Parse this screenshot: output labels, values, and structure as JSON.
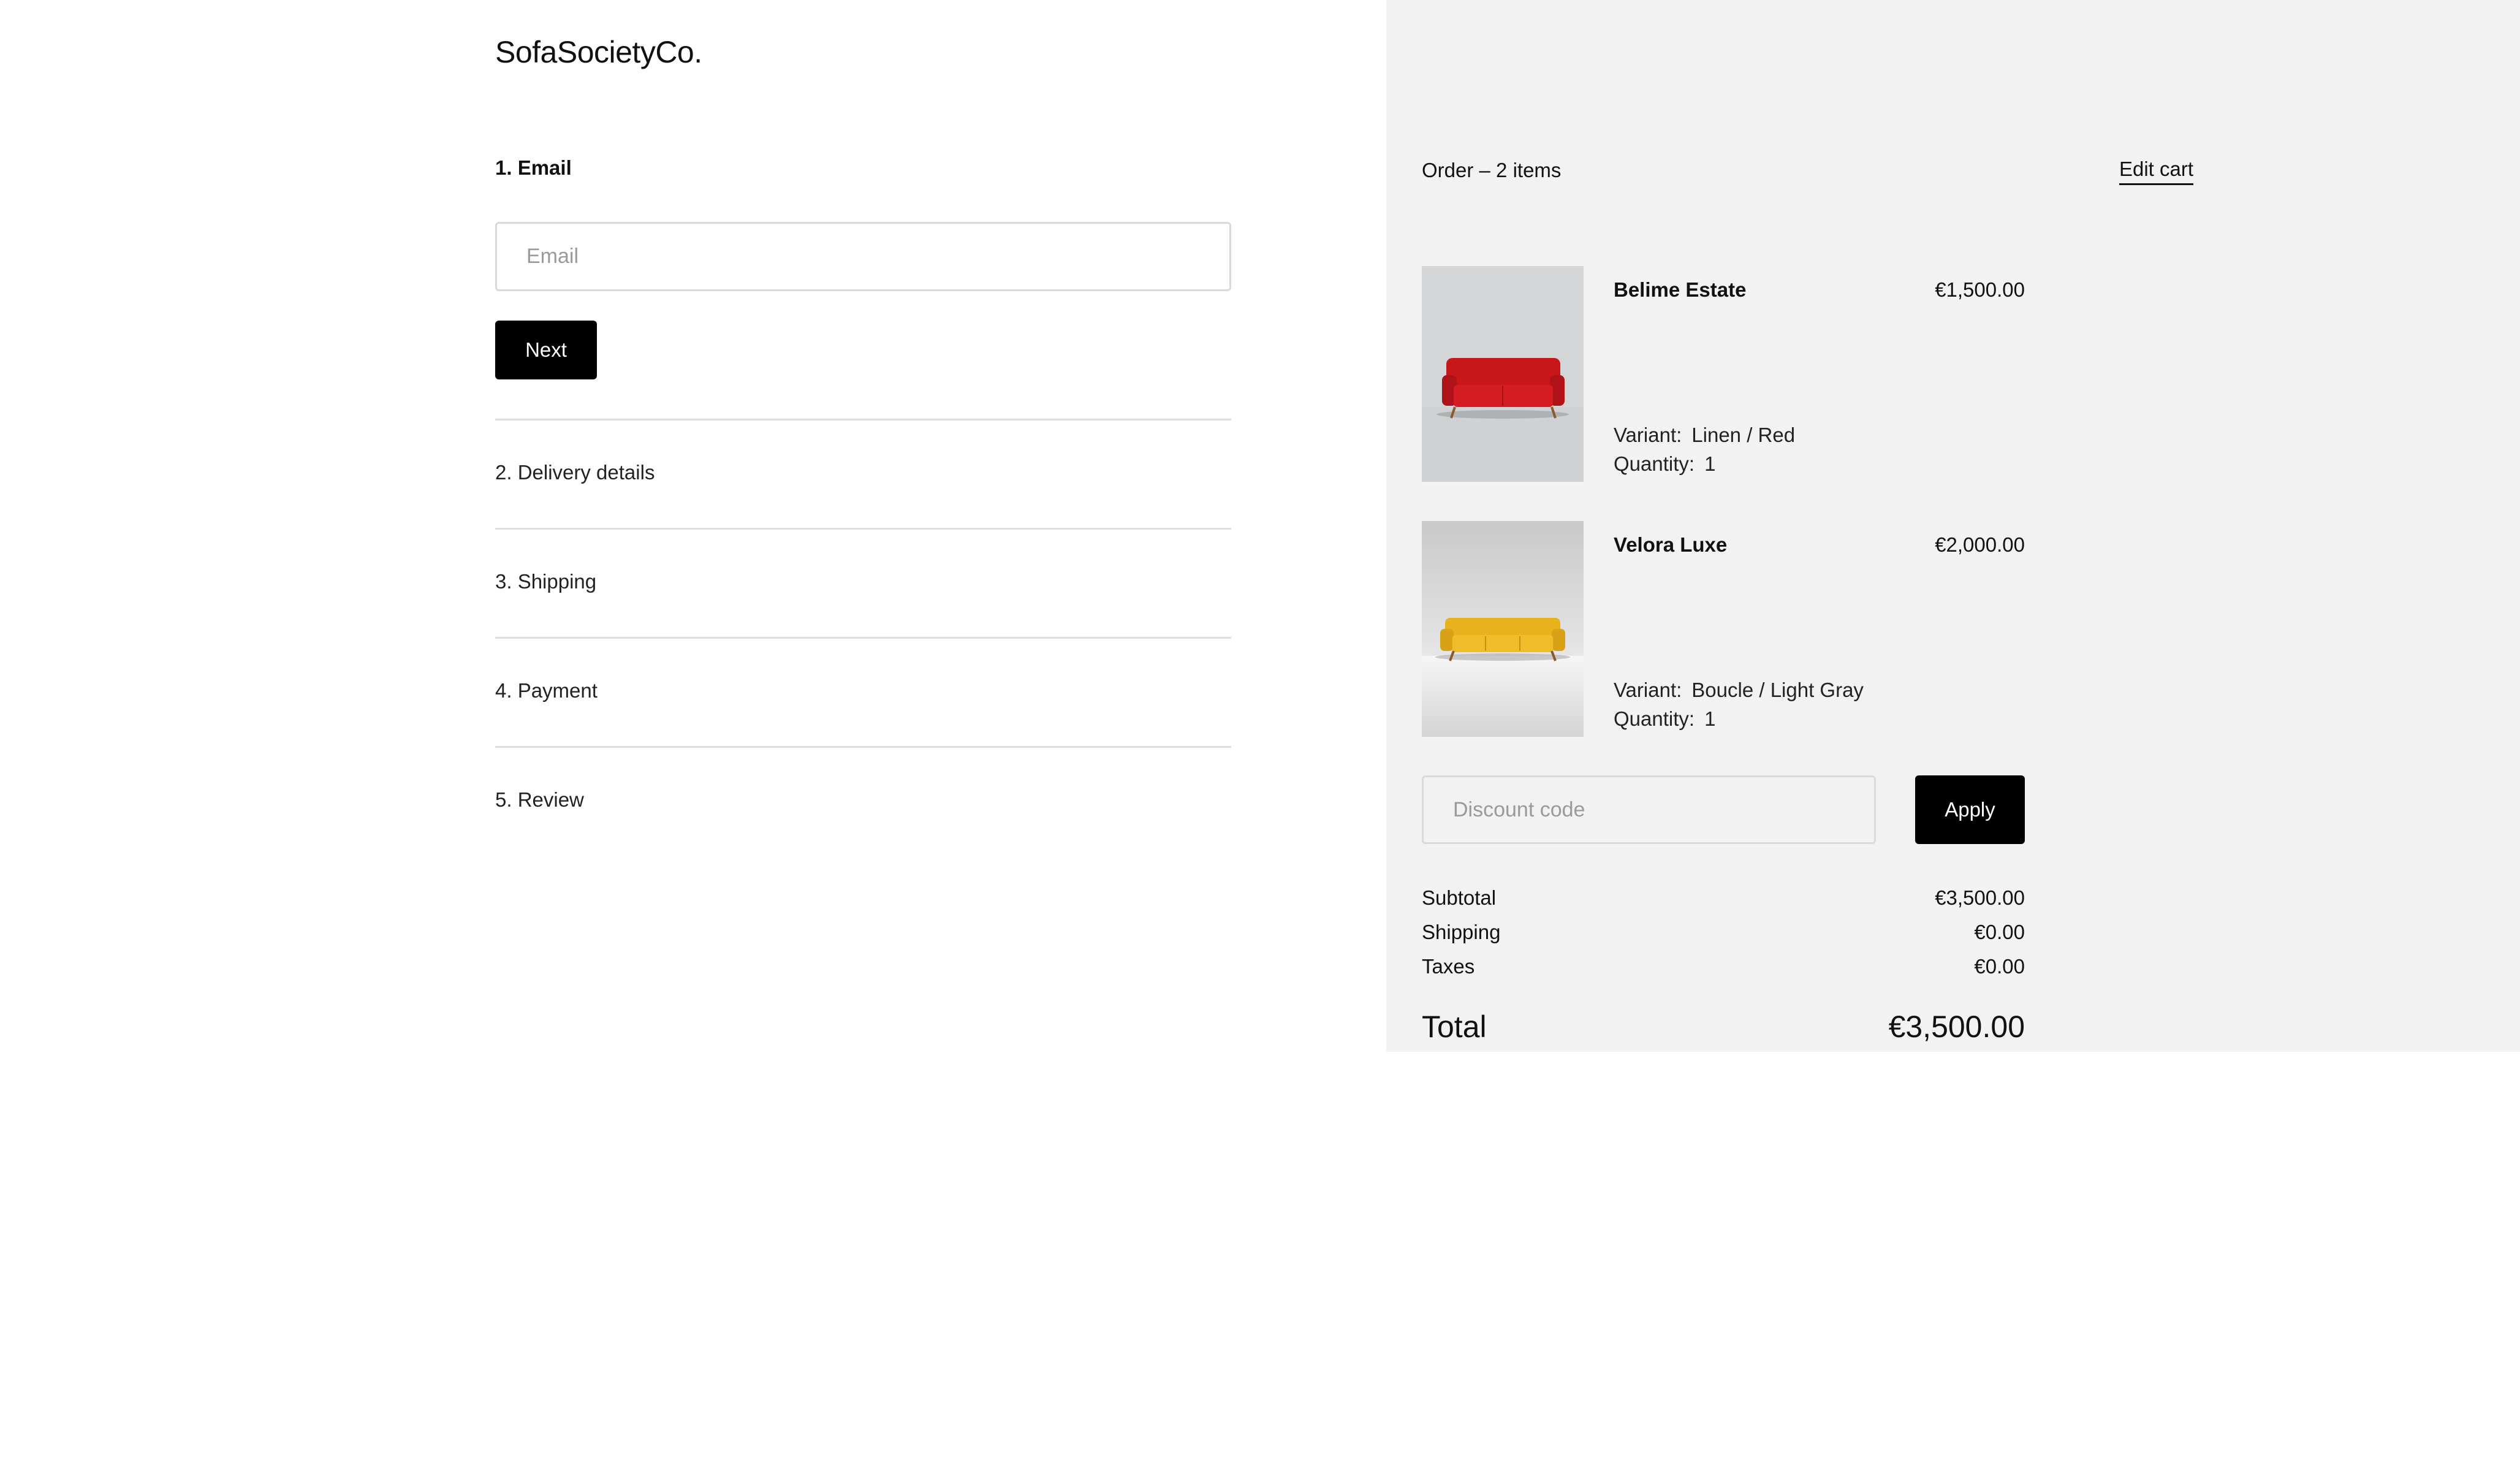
{
  "brand": {
    "logo_text": "SofaSocietyCo."
  },
  "checkout": {
    "email_step": {
      "title": "1. Email",
      "email_placeholder": "Email",
      "next_label": "Next"
    },
    "steps": [
      {
        "label": "2. Delivery details"
      },
      {
        "label": "3. Shipping"
      },
      {
        "label": "4. Payment"
      },
      {
        "label": "5. Review"
      }
    ]
  },
  "order": {
    "title": "Order – 2 items",
    "edit_cart_label": "Edit cart",
    "items": [
      {
        "name": "Belime Estate",
        "price": "€1,500.00",
        "variant_label": "Variant:",
        "variant_value": "Linen / Red",
        "quantity_label": "Quantity:",
        "quantity_value": "1",
        "image_icon": "red-sofa-image",
        "sofa_color": "#c8161b"
      },
      {
        "name": "Velora Luxe",
        "price": "€2,000.00",
        "variant_label": "Variant:",
        "variant_value": "Boucle / Light Gray",
        "quantity_label": "Quantity:",
        "quantity_value": "1",
        "image_icon": "yellow-sofa-image",
        "sofa_color": "#e8b21c"
      }
    ],
    "discount": {
      "placeholder": "Discount code",
      "apply_label": "Apply"
    },
    "summary": {
      "subtotal_label": "Subtotal",
      "subtotal_value": "€3,500.00",
      "shipping_label": "Shipping",
      "shipping_value": "€0.00",
      "taxes_label": "Taxes",
      "taxes_value": "€0.00",
      "total_label": "Total",
      "total_value": "€3,500.00"
    }
  },
  "colors": {
    "summary_background": "#f2f2f2",
    "primary_button": "#000000",
    "divider": "#dedede"
  }
}
